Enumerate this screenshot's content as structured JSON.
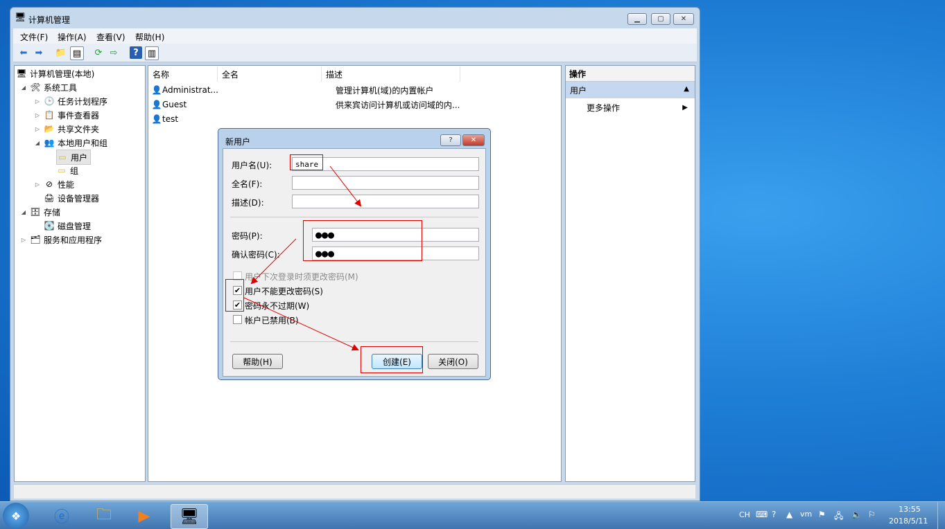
{
  "window": {
    "title": "计算机管理"
  },
  "menu": [
    "文件(F)",
    "操作(A)",
    "查看(V)",
    "帮助(H)"
  ],
  "tree": [
    {
      "label": "计算机管理(本地)",
      "icon": "computer-management-icon"
    },
    {
      "label": "系统工具",
      "icon": "tools-icon"
    },
    {
      "label": "任务计划程序",
      "icon": "clock-icon"
    },
    {
      "label": "事件查看器",
      "icon": "event-viewer-icon"
    },
    {
      "label": "共享文件夹",
      "icon": "shared-folder-icon"
    },
    {
      "label": "本地用户和组",
      "icon": "users-group-icon"
    },
    {
      "label": "用户",
      "icon": "folder-icon"
    },
    {
      "label": "组",
      "icon": "folder-icon"
    },
    {
      "label": "性能",
      "icon": "performance-icon"
    },
    {
      "label": "设备管理器",
      "icon": "device-manager-icon"
    },
    {
      "label": "存储",
      "icon": "storage-icon"
    },
    {
      "label": "磁盘管理",
      "icon": "disk-icon"
    },
    {
      "label": "服务和应用程序",
      "icon": "services-icon"
    }
  ],
  "list": {
    "columns": [
      "名称",
      "全名",
      "描述"
    ],
    "rows": [
      {
        "name": "Administrat...",
        "fullname": "",
        "desc": "管理计算机(域)的内置帐户"
      },
      {
        "name": "Guest",
        "fullname": "",
        "desc": "供来宾访问计算机或访问域的内..."
      },
      {
        "name": "test",
        "fullname": "",
        "desc": ""
      }
    ]
  },
  "actions": {
    "header": "操作",
    "section": "用户",
    "more": "更多操作"
  },
  "dialog": {
    "title": "新用户",
    "username_label": "用户名(U):",
    "username_value": "share",
    "fullname_label": "全名(F):",
    "desc_label": "描述(D):",
    "password_label": "密码(P):",
    "password_value": "●●●",
    "confirm_label": "确认密码(C):",
    "confirm_value": "●●●",
    "cb_must_change": {
      "label": "用户下次登录时须更改密码(M)",
      "checked": false
    },
    "cb_cannot_change": {
      "label": "用户不能更改密码(S)",
      "checked": true
    },
    "cb_never_expires": {
      "label": "密码永不过期(W)",
      "checked": true
    },
    "cb_disabled": {
      "label": "帐户已禁用(B)",
      "checked": false
    },
    "help_btn": "帮助(H)",
    "create_btn": "创建(E)",
    "close_btn": "关闭(O)"
  },
  "tray": {
    "lang": "CH",
    "time": "13:55",
    "date": "2018/5/11"
  },
  "colors": {
    "accent": "#3a80d8",
    "annotation": "#e00000"
  }
}
